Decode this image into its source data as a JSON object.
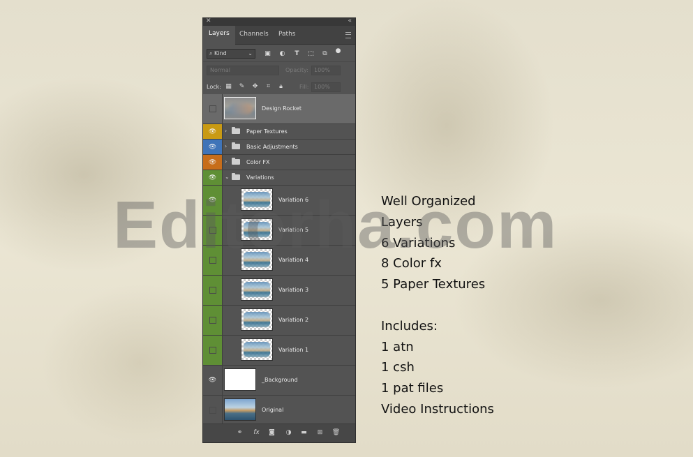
{
  "panel": {
    "tabs": [
      "Layers",
      "Channels",
      "Paths"
    ],
    "filter": {
      "kind_label": "Kind"
    },
    "blend": {
      "mode": "Normal",
      "opacity_label": "Opacity:",
      "opacity_value": "100%"
    },
    "lock": {
      "label": "Lock:",
      "fill_label": "Fill:",
      "fill_value": "100%"
    },
    "layers": [
      {
        "name": "Design Rocket",
        "type": "smart",
        "visible": false,
        "selected": true
      },
      {
        "name": "Paper Textures",
        "type": "group",
        "visible": true,
        "color": "#c99a13",
        "expanded": false
      },
      {
        "name": "Basic Adjustments",
        "type": "group",
        "visible": true,
        "color": "#3f74b8",
        "expanded": false
      },
      {
        "name": "Color FX",
        "type": "group",
        "visible": true,
        "color": "#c76d1a",
        "expanded": false
      },
      {
        "name": "Variations",
        "type": "group",
        "visible": true,
        "color": "#5f8f35",
        "expanded": true
      },
      {
        "name": "Variation 6",
        "type": "layer",
        "visible": true,
        "color": "#5f8f35"
      },
      {
        "name": "Variation 5",
        "type": "layer",
        "visible": false,
        "color": "#5f8f35"
      },
      {
        "name": "Variation 4",
        "type": "layer",
        "visible": false,
        "color": "#5f8f35"
      },
      {
        "name": "Variation 3",
        "type": "layer",
        "visible": false,
        "color": "#5f8f35"
      },
      {
        "name": "Variation 2",
        "type": "layer",
        "visible": false,
        "color": "#5f8f35"
      },
      {
        "name": "Variation 1",
        "type": "layer",
        "visible": false,
        "color": "#5f8f35"
      },
      {
        "name": "_Background",
        "type": "layer",
        "visible": true
      },
      {
        "name": "Original",
        "type": "layer",
        "visible": false
      }
    ]
  },
  "watermark": "Editorha.com",
  "features": {
    "lines": [
      "Well Organized",
      "Layers",
      "6 Variations",
      "8 Color fx",
      "5 Paper Textures"
    ],
    "includes_title": "Includes:",
    "includes": [
      "1 atn",
      "1 csh",
      "1 pat files",
      "Video Instructions"
    ]
  }
}
